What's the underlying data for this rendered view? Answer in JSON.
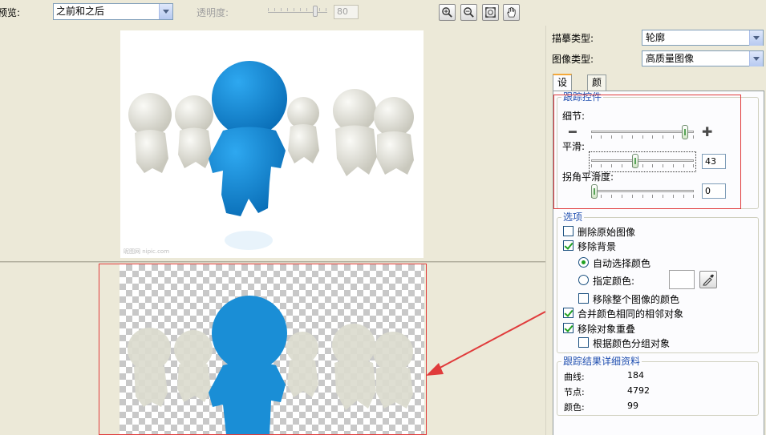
{
  "toolbar": {
    "preview_label": "预览:",
    "preview_mode": "之前和之后",
    "opacity_label": "透明度:",
    "opacity_value": "80",
    "buttons": [
      "zoom-in-icon",
      "zoom-out-icon",
      "fit-icon",
      "pan-hand-icon"
    ]
  },
  "panel": {
    "trace_type_label": "描摹类型:",
    "trace_type_value": "轮廓",
    "image_type_label": "图像类型:",
    "image_type_value": "高质量图像",
    "tabs": [
      "设置",
      "颜色"
    ],
    "trace_controls": {
      "title": "跟踪控件",
      "detail_label": "细节:",
      "detail_minus": "━",
      "detail_plus": "✚",
      "smooth_label": "平滑:",
      "smooth_value": "43",
      "corner_label": "拐角平滑度:",
      "corner_value": "0"
    },
    "options": {
      "title": "选项",
      "delete_original": "删除原始图像",
      "remove_background": "移除背景",
      "auto_color": "自动选择颜色",
      "specify_color": "指定颜色:",
      "remove_whole_color": "移除整个图像的颜色",
      "merge_adjacent": "合并颜色相同的相邻对象",
      "remove_overlap": "移除对象重叠",
      "group_by_color": "根据颜色分组对象"
    },
    "results": {
      "title": "跟踪结果详细资料",
      "curves_label": "曲线:",
      "curves_value": "184",
      "nodes_label": "节点:",
      "nodes_value": "4792",
      "colors_label": "颜色:",
      "colors_value": "99"
    }
  },
  "colors": {
    "accent_red": "#e03b3b",
    "figure_blue": "#1a8ed6",
    "group_title_blue": "#2150b0"
  }
}
